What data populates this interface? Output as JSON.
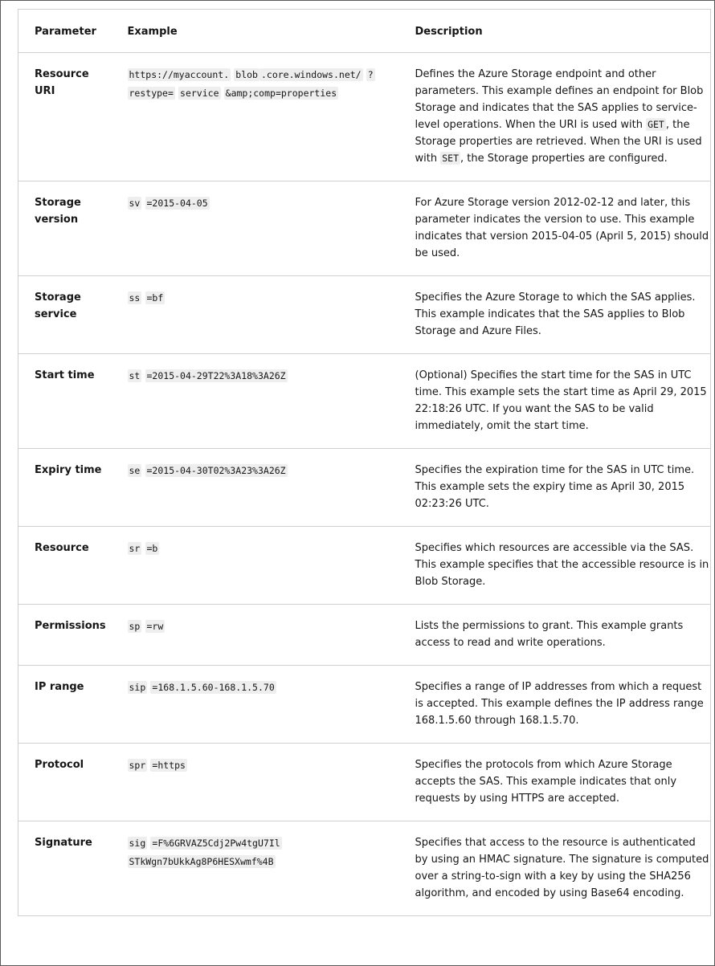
{
  "headers": [
    "Parameter",
    "Example",
    "Description"
  ],
  "rows": [
    {
      "param": "Resource URI",
      "example": [
        "https://myaccount.",
        "blob",
        ".core.windows.net/",
        "?",
        "restype=",
        "service",
        "&amp;comp=properties"
      ],
      "desc": [
        "Defines the Azure Storage endpoint and other parameters. This example defines an endpoint for Blob Storage and indicates that the SAS applies to service-level operations. When the URI is used with ",
        "GET",
        ", the Storage properties are retrieved. When the URI is used with ",
        "SET",
        ", the Storage properties are configured."
      ]
    },
    {
      "param": "Storage version",
      "example": [
        "sv",
        "=2015-04-05"
      ],
      "desc": [
        "For Azure Storage version 2012-02-12 and later, this parameter indicates the version to use. This example indicates that version 2015-04-05 (April 5, 2015) should be used."
      ]
    },
    {
      "param": "Storage service",
      "example": [
        "ss",
        "=bf"
      ],
      "desc": [
        "Specifies the Azure Storage to which the SAS applies. This example indicates that the SAS applies to Blob Storage and Azure Files."
      ]
    },
    {
      "param": "Start time",
      "example": [
        "st",
        "=2015-04-29T22%3A18%3A26Z"
      ],
      "desc": [
        "(Optional) Specifies the start time for the SAS in UTC time. This example sets the start time as April 29, 2015 22:18:26 UTC. If you want the SAS to be valid immediately, omit the start time."
      ]
    },
    {
      "param": "Expiry time",
      "example": [
        "se",
        "=2015-04-30T02%3A23%3A26Z"
      ],
      "desc": [
        "Specifies the expiration time for the SAS in UTC time. This example sets the expiry time as April 30, 2015 02:23:26 UTC."
      ]
    },
    {
      "param": "Resource",
      "example": [
        "sr",
        "=b"
      ],
      "desc": [
        "Specifies which resources are accessible via the SAS. This example specifies that the accessible resource is in Blob Storage."
      ]
    },
    {
      "param": "Permissions",
      "example": [
        "sp",
        "=rw"
      ],
      "desc": [
        "Lists the permissions to grant. This example grants access to read and write operations."
      ]
    },
    {
      "param": "IP range",
      "example": [
        "sip",
        "=168.1.5.60-168.1.5.70"
      ],
      "desc": [
        "Specifies a range of IP addresses from which a request is accepted. This example defines the IP address range 168.1.5.60 through 168.1.5.70."
      ]
    },
    {
      "param": "Protocol",
      "example": [
        "spr",
        "=https"
      ],
      "desc": [
        "Specifies the protocols from which Azure Storage accepts the SAS. This example indicates that only requests by using HTTPS are accepted."
      ]
    },
    {
      "param": "Signature",
      "example": [
        "sig",
        "=F%6GRVAZ5Cdj2Pw4tgU7Il",
        "STkWgn7bUkkAg8P6HESXwmf%4B"
      ],
      "desc": [
        "Specifies that access to the resource is authenticated by using an HMAC signature. The signature is computed over a string-to-sign with a key by using the SHA256 algorithm, and encoded by using Base64 encoding."
      ]
    }
  ]
}
